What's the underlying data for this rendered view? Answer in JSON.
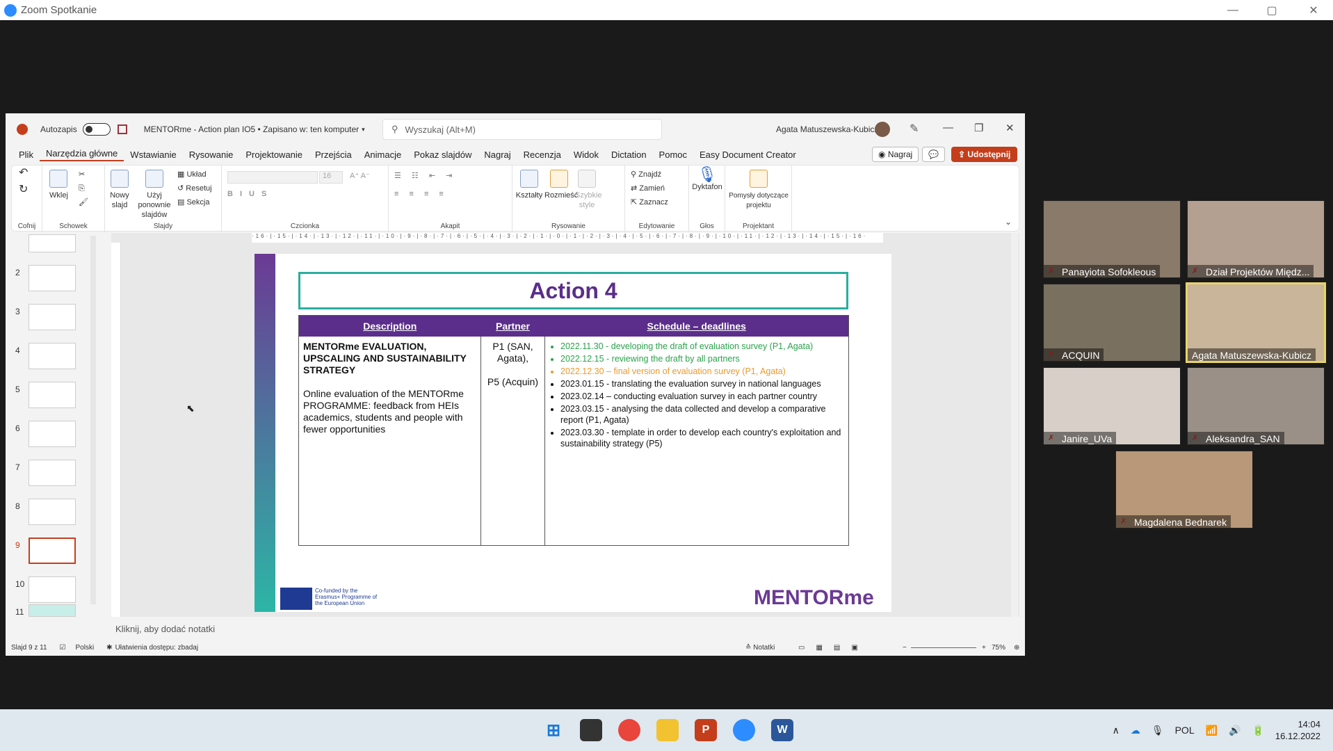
{
  "zoom": {
    "title": "Zoom Spotkanie",
    "minimize": "—",
    "maximize": "▢",
    "close": "✕"
  },
  "ppt": {
    "autosave_label": "Autozapis",
    "doc_title": "MENTORme - Action plan IO5 • Zapisano w: ten komputer",
    "search_placeholder": "Wyszukaj (Alt+M)",
    "user_name": "Agata Matuszewska-Kubicz",
    "menu": [
      "Plik",
      "Narzędzia główne",
      "Wstawianie",
      "Rysowanie",
      "Projektowanie",
      "Przejścia",
      "Animacje",
      "Pokaz slajdów",
      "Nagraj",
      "Recenzja",
      "Widok",
      "Dictation",
      "Pomoc",
      "Easy Document Creator"
    ],
    "record_btn": "Nagraj",
    "share_btn": "Udostępnij",
    "ribbon": {
      "undo_group": "Cofnij",
      "clipboard": {
        "paste": "Wklej",
        "label": "Schowek"
      },
      "slides": {
        "new_slide": "Nowy slajd",
        "reuse": "Użyj ponownie slajdów",
        "layout": "Układ",
        "reset": "Resetuj",
        "section": "Sekcja",
        "label": "Slajdy"
      },
      "font_label": "Czcionka",
      "font_size": "16",
      "paragraph_label": "Akapit",
      "drawing": {
        "shapes": "Kształty",
        "arrange": "Rozmieść",
        "quick_styles": "Szybkie style",
        "label": "Rysowanie"
      },
      "editing": {
        "find": "Znajdź",
        "replace": "Zamień",
        "select": "Zaznacz",
        "label": "Edytowanie"
      },
      "voice": {
        "dictate": "Dyktafon",
        "label": "Głos"
      },
      "designer": {
        "ideas": "Pomysły dotyczące projektu",
        "label": "Projektant"
      }
    },
    "thumb_numbers": [
      "2",
      "3",
      "4",
      "5",
      "6",
      "7",
      "8",
      "9",
      "10",
      "11"
    ],
    "ruler": "·16·|·15·|·14·|·13·|·12·|·11·|·10·|·9·|·8·|·7·|·6·|·5·|·4·|·3·|·2·|·1·|·0·|·1·|·2·|·3·|·4·|·5·|·6·|·7·|·8·|·9·|·10·|·11·|·12·|·13·|·14·|·15·|·16·",
    "notes_placeholder": "Kliknij, aby dodać notatki",
    "status": {
      "slide_count": "Slajd 9 z 11",
      "language": "Polski",
      "accessibility": "Ułatwienia dostępu: zbadaj",
      "notes": "Notatki",
      "zoom": "75%"
    }
  },
  "slide": {
    "title": "Action 4",
    "headers": [
      "Description",
      "Partner",
      "Schedule – deadlines"
    ],
    "description_title": "MENTORme EVALUATION, UPSCALING AND SUSTAINABILITY STRATEGY",
    "description_body": "Online evaluation of the MENTORme PROGRAMME: feedback from HEIs academics, students and people with fewer opportunities",
    "partner_1": "P1 (SAN, Agata),",
    "partner_2": "P5 (Acquin)",
    "schedule": [
      {
        "text": "2022.11.30 - developing the draft of evaluation survey (P1, Agata)",
        "color": "green"
      },
      {
        "text": "2022.12.15 - reviewing the draft by all partners",
        "color": "green"
      },
      {
        "text": "2022.12.30 – final version of evaluation survey (P1, Agata)",
        "color": "orange"
      },
      {
        "text": "2023.01.15 - translating the evaluation survey in national languages",
        "color": "black"
      },
      {
        "text": "2023.02.14 – conducting evaluation survey in each partner country",
        "color": "black"
      },
      {
        "text": "2023.03.15 - analysing the data collected and develop a comparative report (P1, Agata)",
        "color": "black"
      },
      {
        "text": "2023.03.30 - template in order to develop each country's exploitation and sustainability strategy (P5)",
        "color": "black"
      }
    ],
    "eu_text": "Co-funded by the Erasmus+ Programme of the European Union",
    "brand_logo": "MENTORme"
  },
  "participants": [
    {
      "name": "Panayiota Sofokleous"
    },
    {
      "name": "Dział Projektów Międz..."
    },
    {
      "name": "ACQUIN"
    },
    {
      "name": "Agata Matuszewska-Kubicz"
    },
    {
      "name": "Janire_UVa"
    },
    {
      "name": "Aleksandra_SAN"
    },
    {
      "name": "Magdalena Bednarek"
    }
  ],
  "taskbar": {
    "language": "POL",
    "time": "14:04",
    "date": "16.12.2022"
  },
  "colors": {
    "slide_purple": "#5a2e8a",
    "slide_teal": "#2aaea0",
    "ppt_accent": "#c43e1c",
    "active_speaker": "#e8d36a"
  }
}
